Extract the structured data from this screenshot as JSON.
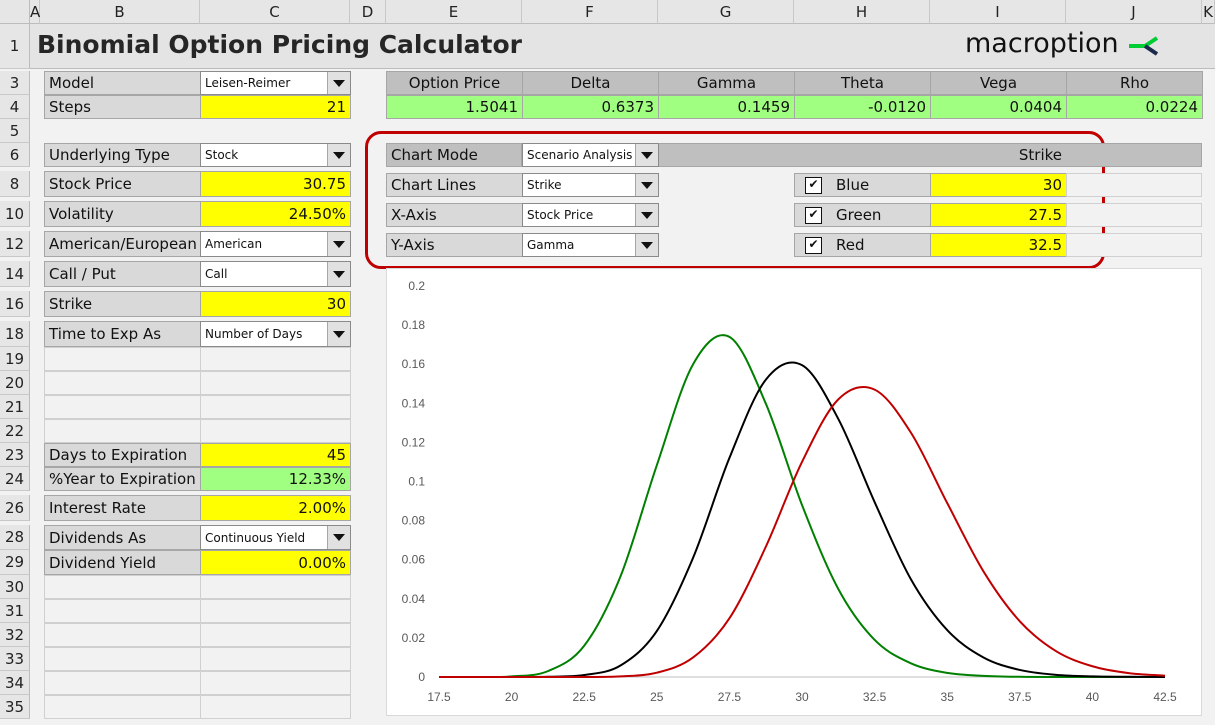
{
  "columns": [
    "A",
    "B",
    "C",
    "D",
    "E",
    "F",
    "G",
    "H",
    "I",
    "J",
    "K"
  ],
  "rows": [
    "1",
    "3",
    "4",
    "5",
    "6",
    "8",
    "10",
    "12",
    "14",
    "16",
    "18",
    "19",
    "20",
    "21",
    "22",
    "23",
    "24",
    "26",
    "28",
    "29",
    "30",
    "31",
    "32",
    "33",
    "34",
    "35"
  ],
  "title": "Binomial Option Pricing Calculator",
  "logo": {
    "text": "macroption",
    "accent": "#00cc33",
    "dark": "#1a2a4a"
  },
  "left_panel": [
    {
      "row": "3",
      "label": "Model",
      "type": "dropdown",
      "value": "Leisen-Reimer"
    },
    {
      "row": "4",
      "label": "Steps",
      "type": "yellow",
      "value": "21"
    },
    {
      "row": "6",
      "label": "Underlying Type",
      "type": "dropdown",
      "value": "Stock"
    },
    {
      "row": "8",
      "label": "Stock Price",
      "type": "yellow",
      "value": "30.75"
    },
    {
      "row": "10",
      "label": "Volatility",
      "type": "yellow",
      "value": "24.50%"
    },
    {
      "row": "12",
      "label": "American/European",
      "type": "dropdown",
      "value": "American"
    },
    {
      "row": "14",
      "label": "Call / Put",
      "type": "dropdown",
      "value": "Call"
    },
    {
      "row": "16",
      "label": "Strike",
      "type": "yellow",
      "value": "30"
    },
    {
      "row": "18",
      "label": "Time to Exp As",
      "type": "dropdown",
      "value": "Number of Days"
    },
    {
      "row": "23",
      "label": "Days to Expiration",
      "type": "yellow",
      "value": "45"
    },
    {
      "row": "24",
      "label": "%Year to Expiration",
      "type": "green",
      "value": "12.33%"
    },
    {
      "row": "26",
      "label": "Interest Rate",
      "type": "yellow",
      "value": "2.00%"
    },
    {
      "row": "28",
      "label": "Dividends As",
      "type": "dropdown",
      "value": "Continuous Yield"
    },
    {
      "row": "29",
      "label": "Dividend Yield",
      "type": "yellow",
      "value": "0.00%"
    }
  ],
  "greeks": [
    {
      "label": "Option Price",
      "value": "1.5041"
    },
    {
      "label": "Delta",
      "value": "0.6373"
    },
    {
      "label": "Gamma",
      "value": "0.1459"
    },
    {
      "label": "Theta",
      "value": "-0.0120"
    },
    {
      "label": "Vega",
      "value": "0.0404"
    },
    {
      "label": "Rho",
      "value": "0.0224"
    }
  ],
  "chart_settings": {
    "chart_mode": {
      "label": "Chart Mode",
      "value": "Scenario Analysis"
    },
    "chart_lines": {
      "label": "Chart Lines",
      "value": "Strike"
    },
    "x_axis": {
      "label": "X-Axis",
      "value": "Stock Price"
    },
    "y_axis": {
      "label": "Y-Axis",
      "value": "Gamma"
    },
    "lines_header": "Strike",
    "lines": [
      {
        "name": "Blue",
        "checked": true,
        "value": "30",
        "color": "#000000"
      },
      {
        "name": "Green",
        "checked": true,
        "value": "27.5",
        "color": "#008000"
      },
      {
        "name": "Red",
        "checked": true,
        "value": "32.5",
        "color": "#c00000"
      }
    ],
    "highlight_color": "#c00000"
  },
  "chart_data": {
    "type": "line",
    "x": [
      17.5,
      18.75,
      20,
      21.25,
      22.5,
      23.75,
      25,
      26.25,
      27.5,
      28.75,
      30,
      31.25,
      32.5,
      33.75,
      35,
      36.25,
      37.5,
      38.75,
      40,
      41.25,
      42.5
    ],
    "xticks": [
      "17.5",
      "20",
      "22.5",
      "25",
      "27.5",
      "30",
      "32.5",
      "35",
      "37.5",
      "40",
      "42.5"
    ],
    "yticks": [
      "0",
      "0.02",
      "0.04",
      "0.06",
      "0.08",
      "0.1",
      "0.12",
      "0.14",
      "0.16",
      "0.18",
      "0.2"
    ],
    "xlim": [
      17.5,
      42.5
    ],
    "ylim": [
      0,
      0.2
    ],
    "grid": false,
    "series": [
      {
        "color": "#008000",
        "values": [
          0,
          0,
          0.0003,
          0.003,
          0.016,
          0.0515,
          0.1083,
          0.16,
          0.174,
          0.14,
          0.088,
          0.045,
          0.019,
          0.007,
          0.0021,
          0.0006,
          0.0001,
          0,
          0,
          0,
          0
        ]
      },
      {
        "color": "#000000",
        "values": [
          0,
          0,
          0,
          0.0001,
          0.001,
          0.0059,
          0.0235,
          0.061,
          0.112,
          0.152,
          0.1595,
          0.132,
          0.0895,
          0.05,
          0.024,
          0.01,
          0.0036,
          0.0011,
          0.0003,
          0.0001,
          0
        ]
      },
      {
        "color": "#c00000",
        "values": [
          0,
          0,
          0,
          0,
          0,
          0.0003,
          0.0022,
          0.01,
          0.03,
          0.0665,
          0.11,
          0.142,
          0.147,
          0.125,
          0.089,
          0.054,
          0.0285,
          0.0132,
          0.0055,
          0.002,
          0.0007
        ]
      }
    ]
  }
}
